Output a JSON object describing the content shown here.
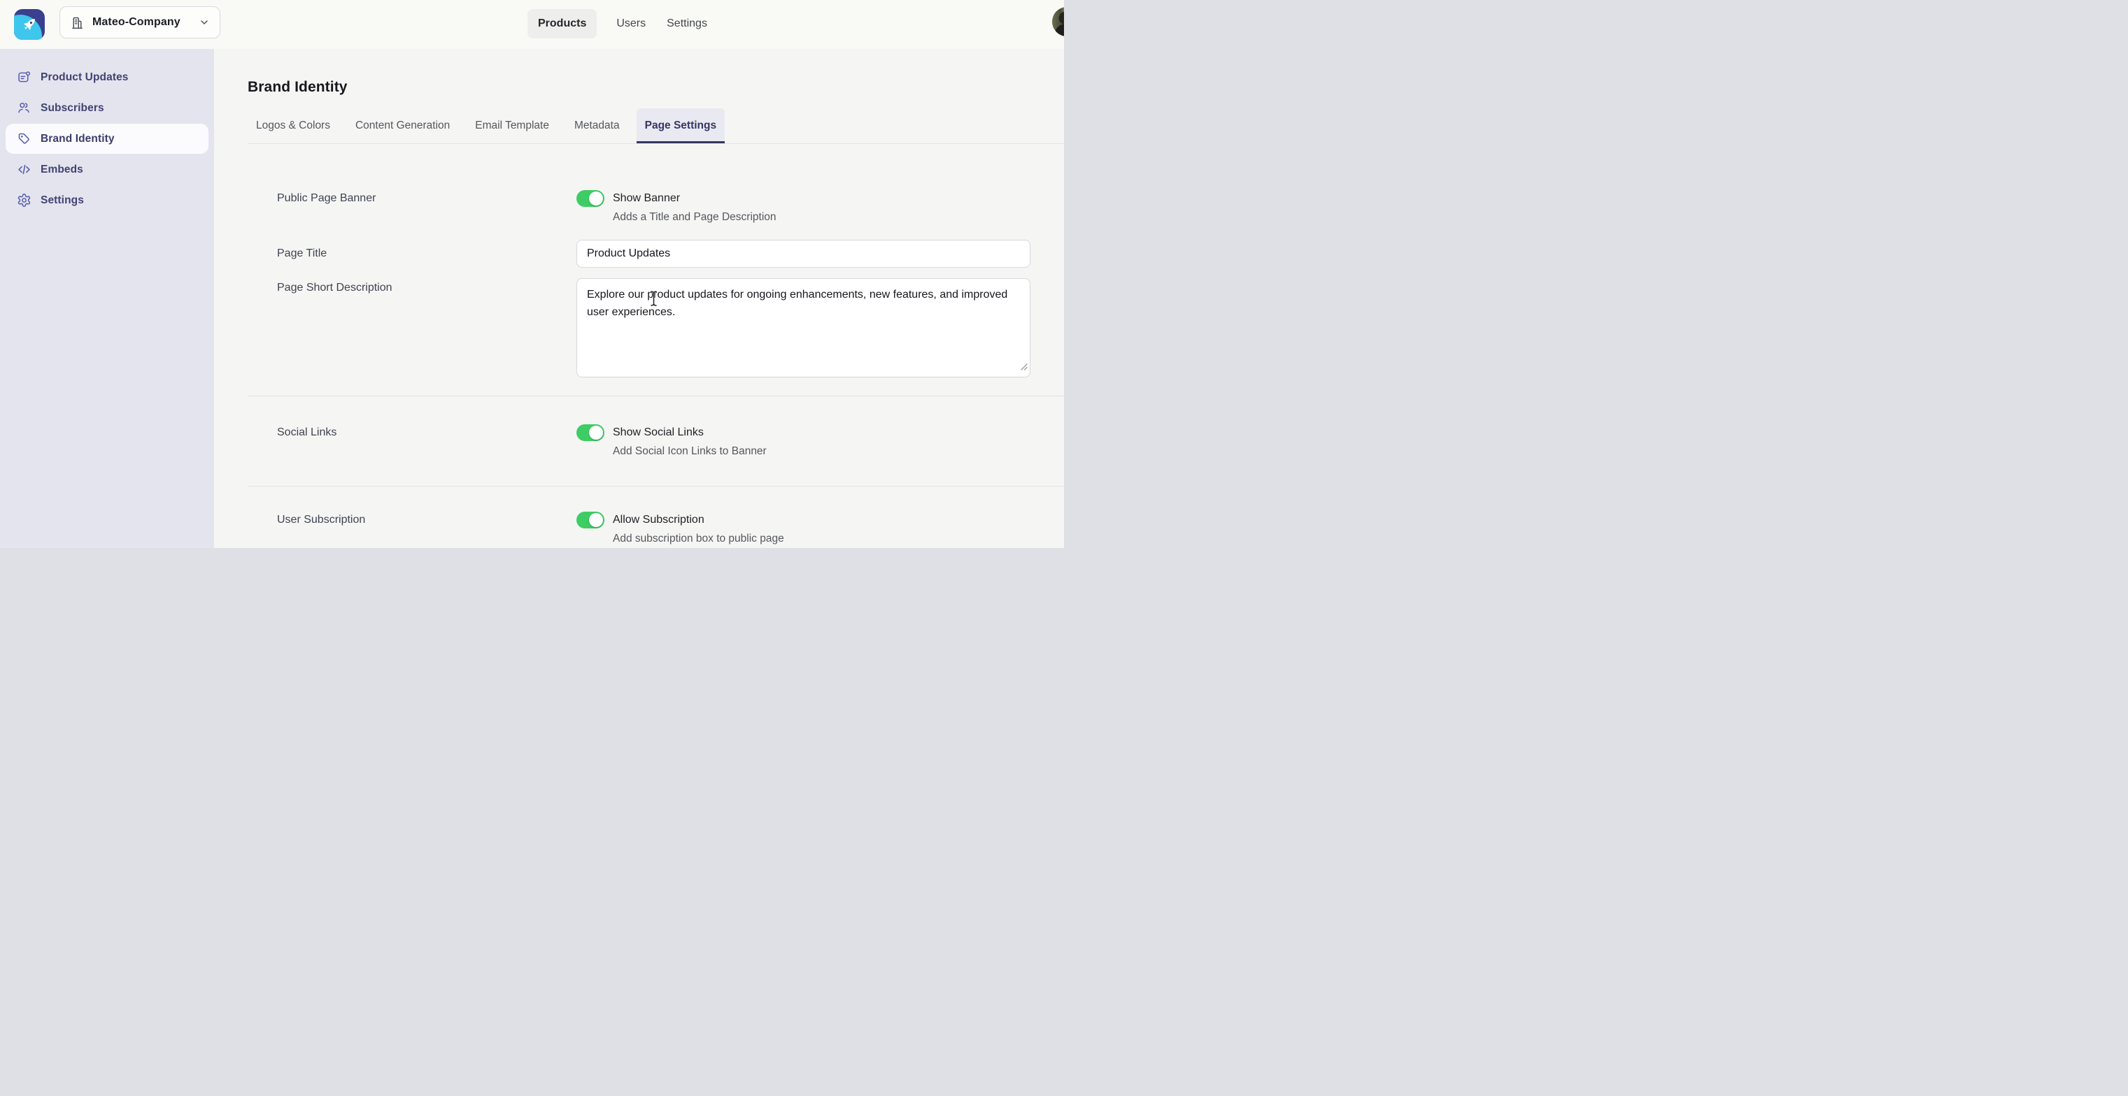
{
  "header": {
    "company_selector": {
      "label": "Mateo-Company"
    },
    "nav": [
      {
        "label": "Products",
        "active": true
      },
      {
        "label": "Users",
        "active": false
      },
      {
        "label": "Settings",
        "active": false
      }
    ]
  },
  "sidebar": {
    "items": [
      {
        "label": "Product Updates",
        "icon": "changelog-icon",
        "active": false
      },
      {
        "label": "Subscribers",
        "icon": "users-icon",
        "active": false
      },
      {
        "label": "Brand Identity",
        "icon": "tag-icon",
        "active": true
      },
      {
        "label": "Embeds",
        "icon": "code-icon",
        "active": false
      },
      {
        "label": "Settings",
        "icon": "gear-icon",
        "active": false
      }
    ]
  },
  "main": {
    "title": "Brand Identity",
    "tabs": [
      {
        "label": "Logos & Colors",
        "active": false
      },
      {
        "label": "Content Generation",
        "active": false
      },
      {
        "label": "Email Template",
        "active": false
      },
      {
        "label": "Metadata",
        "active": false
      },
      {
        "label": "Page Settings",
        "active": true
      }
    ],
    "form": {
      "public_page_banner": {
        "label": "Public Page Banner",
        "toggle_on": true,
        "toggle_label": "Show Banner",
        "toggle_desc": "Adds a Title and Page Description"
      },
      "page_title": {
        "label": "Page Title",
        "value": "Product Updates"
      },
      "page_short_description": {
        "label": "Page Short Description",
        "value": "Explore our product updates for ongoing enhancements, new features, and improved user experiences."
      },
      "social_links": {
        "label": "Social Links",
        "toggle_on": true,
        "toggle_label": "Show Social Links",
        "toggle_desc": "Add Social Icon Links to Banner"
      },
      "user_subscription": {
        "label": "User Subscription",
        "toggle_on": true,
        "toggle_label": "Allow Subscription",
        "toggle_desc": "Add subscription box to public page"
      }
    }
  },
  "colors": {
    "accent_indigo": "#343763",
    "sidebar_bg": "#e4e4ee",
    "sidebar_icon": "#5a5fae",
    "toggle_on_green": "#3ecd64",
    "logo_bg": "#3a3f8e",
    "logo_crescent": "#3fc6ec"
  }
}
